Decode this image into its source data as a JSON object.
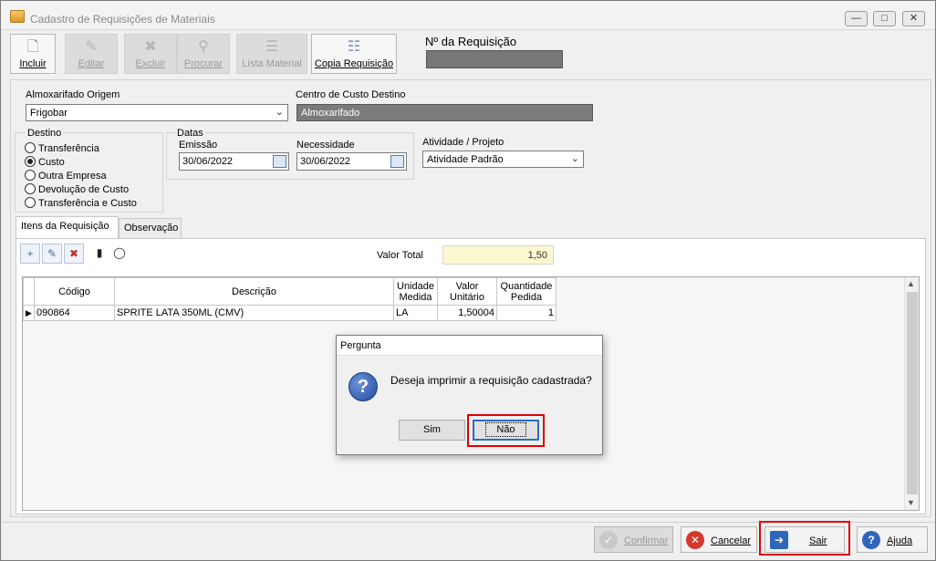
{
  "window": {
    "title": "Cadastro de Requisições de Materiais"
  },
  "toolbar": {
    "incluir": "Incluir",
    "editar": "Editar",
    "excluir": "Excluir",
    "procurar": "Procurar",
    "lista_material": "Lista Material",
    "copia_requisicao": "Copia Requisição"
  },
  "requisicao": {
    "label": "Nº da Requisição",
    "value": ""
  },
  "form": {
    "almoxarifado_label": "Almoxarifado Origem",
    "almoxarifado_value": "Frigobar",
    "centro_label": "Centro de Custo Destino",
    "centro_value": "Almoxarifado",
    "destino_label": "Destino",
    "destino_options": [
      "Transferência",
      "Custo",
      "Outra Empresa",
      "Devolução de Custo",
      "Transferência e Custo"
    ],
    "destino_selected": "Custo",
    "datas_label": "Datas",
    "emissao_label": "Emissão",
    "emissao_value": "30/06/2022",
    "necessidade_label": "Necessidade",
    "necessidade_value": "30/06/2022",
    "atividade_label": "Atividade / Projeto",
    "atividade_value": "Atividade Padrão"
  },
  "tabs": [
    {
      "label": "Itens da Requisição",
      "active": true
    },
    {
      "label": "Observação",
      "active": false
    }
  ],
  "itens": {
    "valor_total_label": "Valor Total",
    "valor_total": "1,50",
    "columns": [
      "Código",
      "Descrição",
      "Unidade Medida",
      "Valor Unitário",
      "Quantidade Pedida"
    ],
    "column_lines": [
      [
        "Código"
      ],
      [
        "Descrição"
      ],
      [
        "Unidade",
        "Medida"
      ],
      [
        "Valor",
        "Unitário"
      ],
      [
        "Quantidade",
        "Pedida"
      ]
    ],
    "rows": [
      [
        "090864",
        "SPRITE LATA 350ML (CMV)",
        "LA",
        "1,50004",
        "1"
      ]
    ]
  },
  "dialog": {
    "title": "Pergunta",
    "message": "Deseja imprimir a requisição cadastrada?",
    "sim": "Sim",
    "nao": "Não"
  },
  "bottom": {
    "confirmar": "Confirmar",
    "cancelar": "Cancelar",
    "sair": "Sair",
    "ajuda": "Ajuda"
  },
  "colors": {
    "highlight": "#e00000",
    "total_bg": "#fcf8d0"
  }
}
